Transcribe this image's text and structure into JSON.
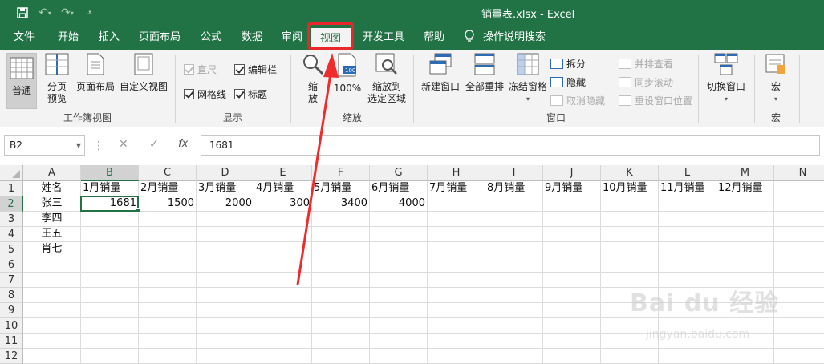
{
  "app": {
    "title": "销量表.xlsx  -  Excel",
    "accent": "#217346"
  },
  "qat": {
    "save_icon": "save-icon",
    "undo_icon": "undo-icon",
    "redo_icon": "redo-icon",
    "customize_icon": "customize-qat-icon"
  },
  "tabs": [
    {
      "label": "文件"
    },
    {
      "label": "开始"
    },
    {
      "label": "插入"
    },
    {
      "label": "页面布局"
    },
    {
      "label": "公式"
    },
    {
      "label": "数据"
    },
    {
      "label": "审阅"
    },
    {
      "label": "视图"
    },
    {
      "label": "开发工具"
    },
    {
      "label": "帮助"
    },
    {
      "label": "操作说明搜索"
    }
  ],
  "active_tab": "视图",
  "ribbon": {
    "workbook_views": {
      "label": "工作簿视图",
      "normal": "普通",
      "page_break_line1": "分页",
      "page_break_line2": "预览",
      "page_layout": "页面布局",
      "custom_views": "自定义视图"
    },
    "show": {
      "label": "显示",
      "ruler": "直尺",
      "formula_bar": "编辑栏",
      "gridlines": "网格线",
      "headings": "标题"
    },
    "zoom": {
      "label": "缩放",
      "zoom_line1": "缩",
      "zoom_line2": "放",
      "hundred": "100%",
      "to_selection_line1": "缩放到",
      "to_selection_line2": "选定区域"
    },
    "window": {
      "label": "窗口",
      "new_window": "新建窗口",
      "arrange_all": "全部重排",
      "freeze_panes": "冻结窗格",
      "split": "拆分",
      "hide": "隐藏",
      "unhide": "取消隐藏",
      "side_by_side": "并排查看",
      "sync_scroll": "同步滚动",
      "reset_position": "重设窗口位置",
      "switch_windows": "切换窗口"
    },
    "macros": {
      "label": "宏",
      "macros": "宏"
    }
  },
  "formula_bar": {
    "name_box": "B2",
    "fx": "fx",
    "value": "1681"
  },
  "sheet": {
    "columns": [
      "A",
      "B",
      "C",
      "D",
      "E",
      "F",
      "G",
      "H",
      "I",
      "J",
      "K",
      "L",
      "M",
      "N"
    ],
    "rows": [
      "1",
      "2",
      "3",
      "4",
      "5",
      "6",
      "7",
      "8",
      "9",
      "10",
      "11",
      "12"
    ],
    "selected_cell": "B2",
    "header_row": [
      "姓名",
      "1月销量",
      "2月销量",
      "3月销量",
      "4月销量",
      "5月销量",
      "6月销量",
      "7月销量",
      "8月销量",
      "9月销量",
      "10月销量",
      "11月销量",
      "12月销量",
      ""
    ],
    "names": [
      "张三",
      "李四",
      "王五",
      "肖七"
    ],
    "row2_values": [
      "1681",
      "1500",
      "2000",
      "300",
      "3400",
      "4000"
    ]
  },
  "watermark": {
    "brand": "Bai du 经验",
    "url": "jingyan.baidu.com"
  }
}
